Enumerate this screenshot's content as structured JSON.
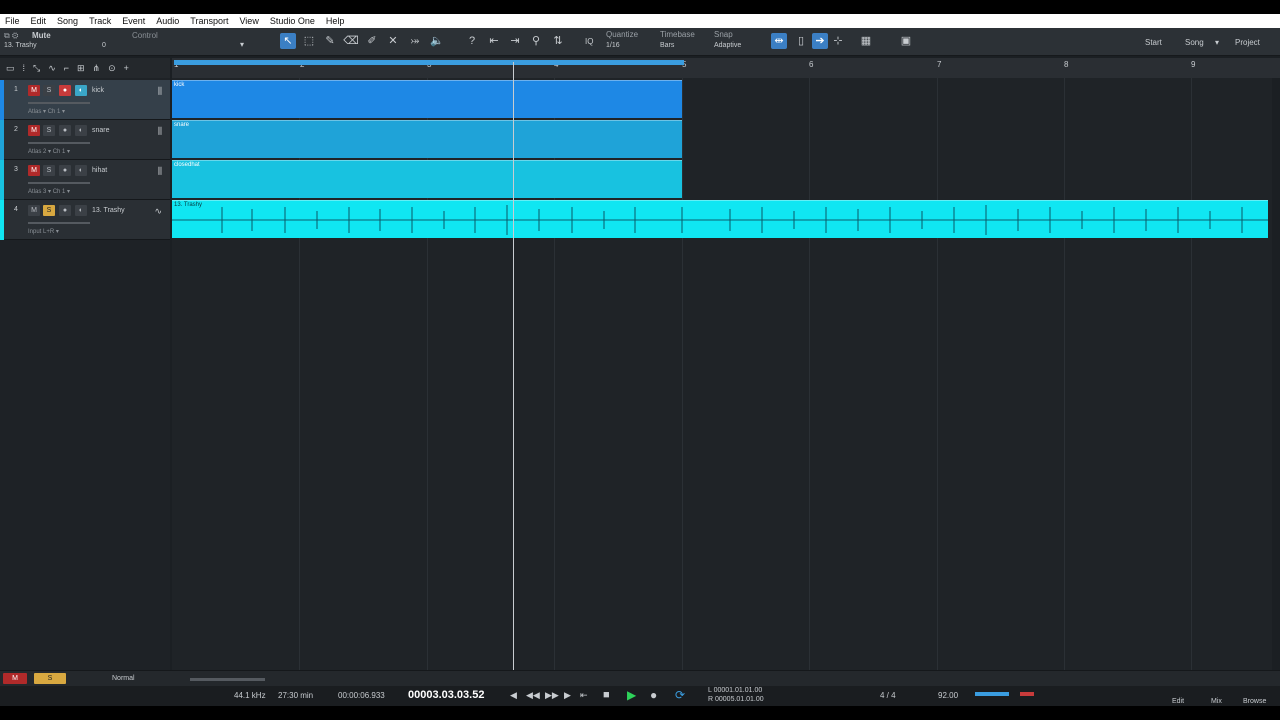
{
  "menubar": [
    "File",
    "Edit",
    "Song",
    "Track",
    "Event",
    "Audio",
    "Transport",
    "View",
    "Studio One",
    "Help"
  ],
  "inspector": {
    "mute_label": "Mute",
    "track_label": "13. Trashy",
    "value": "0",
    "control_label": "Control"
  },
  "toolbar": {
    "quantize_label": "Quantize",
    "quantize_value": "1/16",
    "timebase_label": "Timebase",
    "timebase_value": "Bars",
    "snap_label": "Snap",
    "snap_value": "Adaptive",
    "iq_label": "IQ",
    "start_label": "Start",
    "song_label": "Song",
    "project_label": "Project",
    "tools": [
      "arrow-icon",
      "range-icon",
      "pencil-icon",
      "eraser-icon",
      "paint-icon",
      "mute-tool-icon",
      "split-icon",
      "listen-icon"
    ]
  },
  "ruler": [
    "1",
    "2",
    "3",
    "4",
    "5",
    "6",
    "7",
    "8",
    "9"
  ],
  "tracks": [
    {
      "num": "1",
      "name": "kick",
      "instrument": "Atlas",
      "channel": "Ch 1",
      "clip": "kick",
      "color": "#1e88e5"
    },
    {
      "num": "2",
      "name": "snare",
      "instrument": "Atlas 2",
      "channel": "Ch 1",
      "clip": "snare",
      "color": "#1fa3d8"
    },
    {
      "num": "3",
      "name": "hihat",
      "instrument": "Atlas 3",
      "channel": "Ch 1",
      "clip": "closedhat",
      "color": "#18c2e0"
    },
    {
      "num": "4",
      "name": "13. Trashy",
      "instrument": "Input L+R",
      "channel": "",
      "clip": "13. Trashy",
      "color": "#10e6f2"
    }
  ],
  "bottombar": {
    "mode": "Normal"
  },
  "transport": {
    "sample_rate": "44.1 kHz",
    "record_time": "27:30 min",
    "seconds": "00:00:06.933",
    "position": "00003.03.03.52",
    "left_locator": "00001.01.01.00",
    "right_locator": "00005.01.01.00",
    "signature": "4 / 4",
    "tempo": "92.00",
    "views": [
      "Edit",
      "Mix",
      "Browse"
    ]
  },
  "colors": {
    "accent": "#3b7fc4",
    "mute": "#b02a2a",
    "record": "#c83b3b",
    "audio_clip": "#10e6f2"
  }
}
